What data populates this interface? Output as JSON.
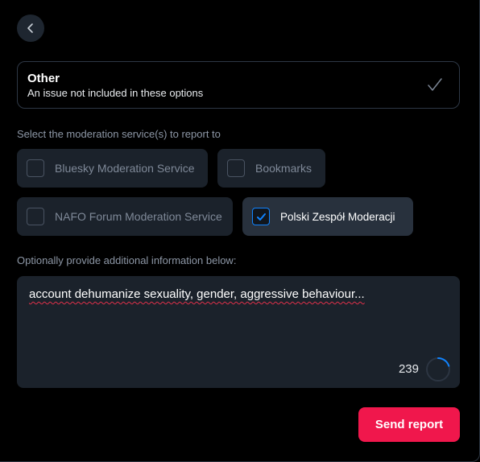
{
  "header": {
    "back_icon": "chevron-left-icon"
  },
  "reason": {
    "title": "Other",
    "description": "An issue not included in these options",
    "check_icon": "checkmark-icon"
  },
  "services": {
    "label": "Select the moderation service(s) to report to",
    "items": [
      {
        "label": "Bluesky Moderation Service",
        "checked": false
      },
      {
        "label": "Bookmarks",
        "checked": false
      },
      {
        "label": "NAFO Forum Moderation Service",
        "checked": false
      },
      {
        "label": "Polski Zespół Moderacji",
        "checked": true
      }
    ]
  },
  "details": {
    "label": "Optionally provide additional information below:",
    "value": "account dehumanize sexuality, gender, aggressive behaviour...",
    "remaining_chars": "239",
    "progress_fraction": 0.2
  },
  "actions": {
    "send_label": "Send report"
  },
  "colors": {
    "accent": "#1083fe",
    "danger": "#f0174c",
    "surface": "#1b222b",
    "background": "#000000"
  }
}
